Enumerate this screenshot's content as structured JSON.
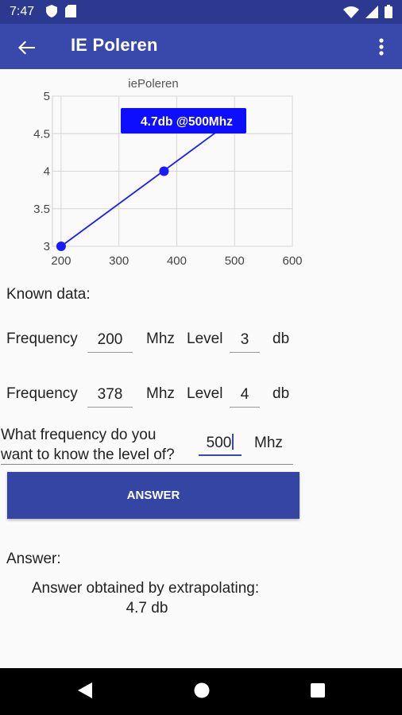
{
  "status": {
    "time": "7:47"
  },
  "app_bar": {
    "title": "IE Poleren"
  },
  "chart_data": {
    "type": "line",
    "title": "iePoleren",
    "x": [
      200,
      378
    ],
    "y": [
      3,
      4
    ],
    "extrapolated_x": 500,
    "extrapolated_y": 4.7,
    "tooltip": "4.7db @500Mhz",
    "xlim": [
      185,
      600
    ],
    "ylim": [
      3,
      5
    ],
    "xticks": [
      "200",
      "300",
      "400",
      "500",
      "600"
    ],
    "yticks": [
      "3",
      "3.5",
      "4",
      "4.5",
      "5"
    ],
    "grid": true,
    "color": "#1a1aff"
  },
  "known": {
    "heading": "Known data:",
    "row1": {
      "freq_label": "Frequency",
      "freq_value": "200",
      "freq_unit": "Mhz",
      "level_label": "Level",
      "level_value": "3",
      "level_unit": "db"
    },
    "row2": {
      "freq_label": "Frequency",
      "freq_value": "378",
      "freq_unit": "Mhz",
      "level_label": "Level",
      "level_value": "4",
      "level_unit": "db"
    }
  },
  "query": {
    "question_line1": "What frequency do you",
    "question_line2": "want to know the level of?",
    "value": "500",
    "unit": "Mhz"
  },
  "answer_button": {
    "label": "ANSWER"
  },
  "answer": {
    "heading": "Answer:",
    "line1": "Answer obtained by extrapolating:",
    "line2": "4.7 db"
  },
  "colors": {
    "primary": "#3949ab",
    "status": "#2b3990",
    "button": "#3545a3"
  }
}
